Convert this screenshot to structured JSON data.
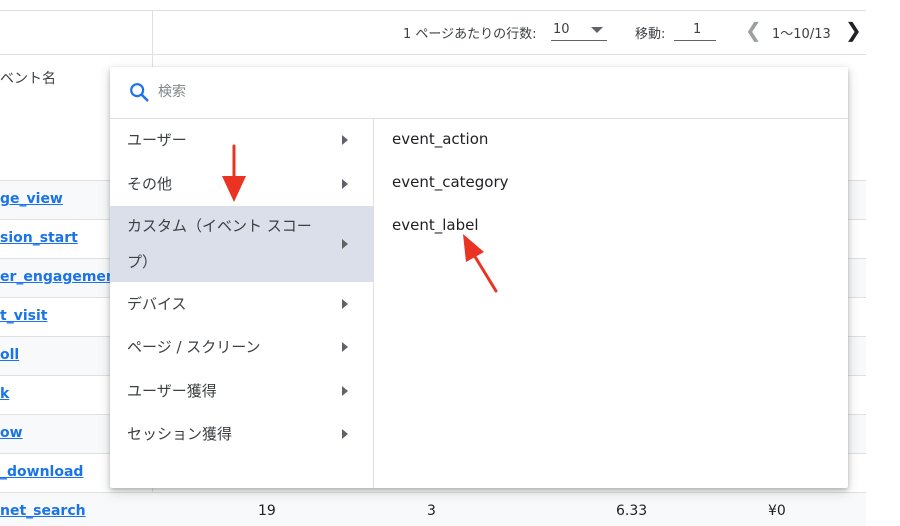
{
  "pager": {
    "rows_per_page_label": "1 ページあたりの行数:",
    "rows_per_page_value": "10",
    "move_label": "移動:",
    "page_value": "1",
    "range_text": "1〜10/13"
  },
  "table": {
    "event_name_header": "ベント名",
    "event_rows": [
      "ge_view",
      "sion_start",
      "er_engagement",
      "t_visit",
      "oll",
      "k",
      "ow",
      "_download",
      "net_search"
    ],
    "last_row_values": [
      "19",
      "3",
      "6.33",
      "¥0"
    ]
  },
  "dropdown": {
    "search_placeholder": "検索",
    "categories": [
      {
        "label": "ユーザー"
      },
      {
        "label": "その他"
      },
      {
        "label": "カスタム（イベント スコープ）",
        "line1": "カスタム（イベント スコー",
        "line2": "プ）",
        "active": true
      },
      {
        "label": "デバイス"
      },
      {
        "label": "ページ / スクリーン"
      },
      {
        "label": "ユーザー獲得"
      },
      {
        "label": "セッション獲得"
      }
    ],
    "items": [
      "event_action",
      "event_category",
      "event_label"
    ]
  },
  "colors": {
    "link": "#1a73e8",
    "active_category_bg": "#dadfe9",
    "annotation_arrow": "#ea3323",
    "search_icon": "#1a73e8"
  },
  "icons": [
    "search-icon",
    "chevron-right-icon",
    "chevron-left-icon",
    "dropdown-caret-icon"
  ]
}
